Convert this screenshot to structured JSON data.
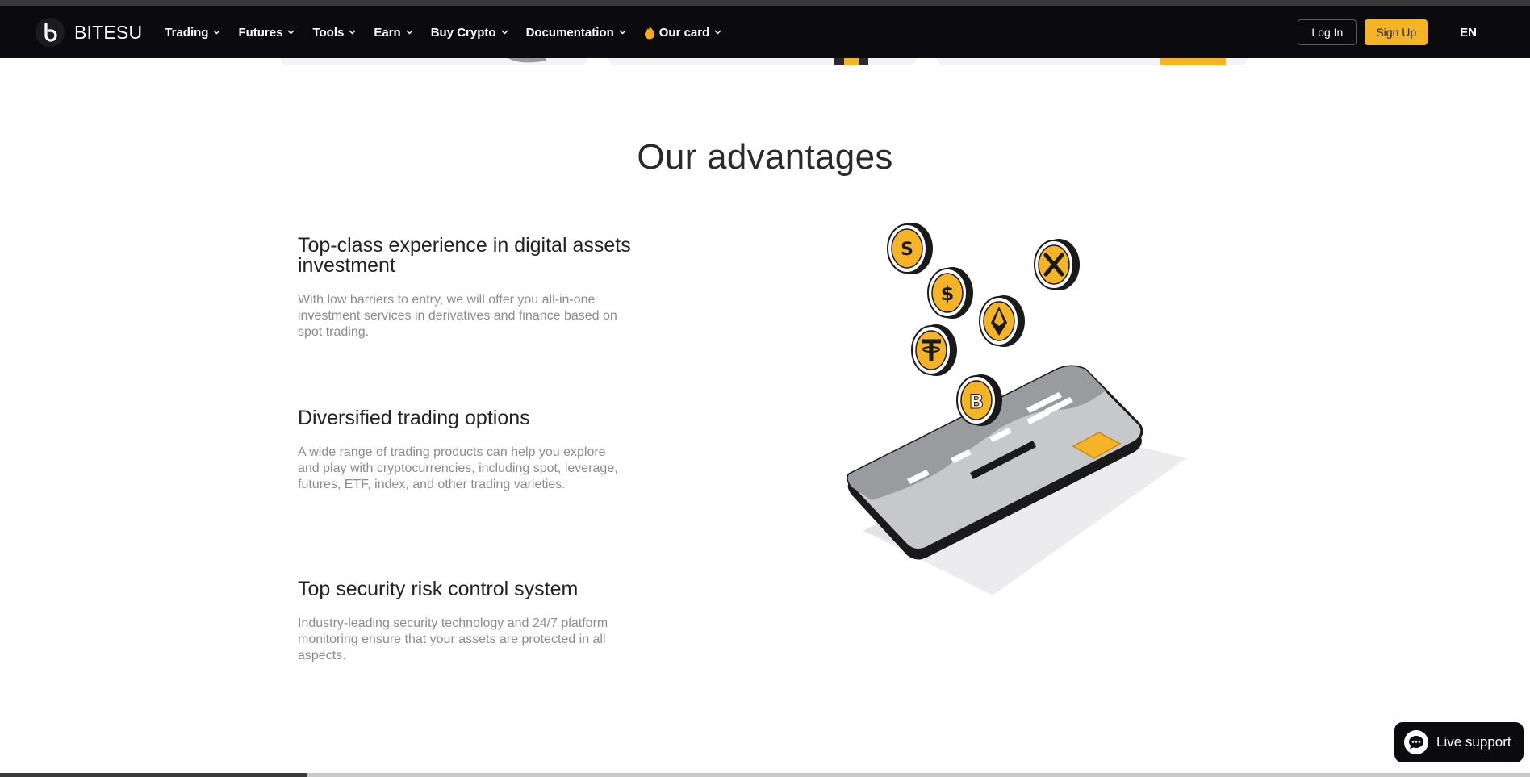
{
  "brand": {
    "name": "BITESU",
    "accent": "#f5b425",
    "nav_bg": "#0b0b0f"
  },
  "nav": {
    "items": [
      {
        "label": "Trading"
      },
      {
        "label": "Futures"
      },
      {
        "label": "Tools"
      },
      {
        "label": "Earn"
      },
      {
        "label": "Buy Crypto"
      },
      {
        "label": "Documentation"
      },
      {
        "label": "Our card",
        "icon": "flame-icon"
      }
    ],
    "login_label": "Log In",
    "signup_label": "Sign Up",
    "language": "EN"
  },
  "advantages": {
    "title": "Our advantages",
    "items": [
      {
        "heading": "Top-class experience in digital assets investment",
        "text": "With low barriers to entry, we will offer you all-in-one investment services in derivatives and finance based on spot trading."
      },
      {
        "heading": "Diversified trading options",
        "text": "A wide range of trading products can help you explore and play with cryptocurrencies, including spot, leverage, futures, ETF, index, and other trading varieties."
      },
      {
        "heading": "Top security risk control system",
        "text": "Industry-leading security technology and 24/7 platform monitoring ensure that your assets are protected in all aspects."
      }
    ]
  },
  "support": {
    "label": "Live support",
    "icon": "chat-icon"
  }
}
